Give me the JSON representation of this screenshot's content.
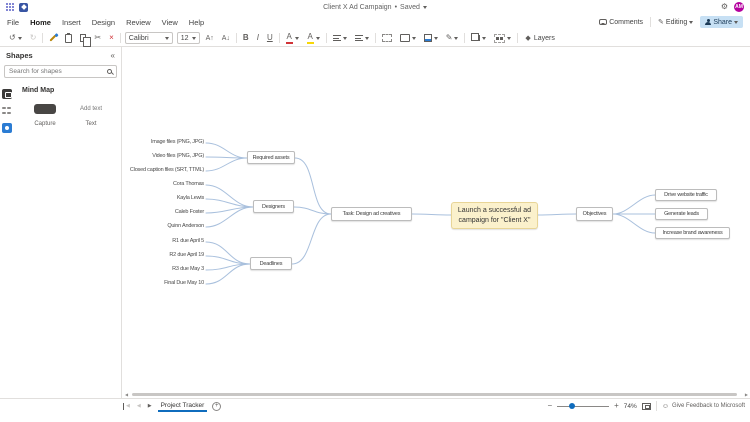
{
  "icons": {
    "undo": "↺",
    "redo": "↻",
    "cut": "✂",
    "delete": "×",
    "grow_font": "A↑",
    "shrink_font": "A↓",
    "bold": "B",
    "italic": "I",
    "underline": "U",
    "font_color": "A",
    "highlight": "A",
    "pencil": "✎",
    "layers": "◆",
    "gear": "⚙",
    "collapse_panel": "«",
    "prev": "◀",
    "next": "▶",
    "minus": "−",
    "plus": "+",
    "add_page": "+",
    "smiley": "☺"
  },
  "titlebar": {
    "title": "Client X Ad Campaign",
    "separator": "•",
    "status": "Saved",
    "avatar": "AM"
  },
  "menubar": {
    "items": [
      "File",
      "Home",
      "Insert",
      "Design",
      "Review",
      "View",
      "Help"
    ],
    "active": "Home",
    "comments": "Comments",
    "editing": "Editing",
    "share": "Share"
  },
  "toolbar": {
    "font_name": "Calibri",
    "font_size": "12",
    "layers": "Layers"
  },
  "shapes_panel": {
    "title": "Shapes",
    "search_placeholder": "Search for shapes",
    "section": "Mind Map",
    "item1_label": "Capture",
    "item2_preview": "Add text",
    "item2_label": "Text"
  },
  "mindmap": {
    "center": "Launch a successful ad campaign for \"Client X\"",
    "task": "Task: Design ad creatives",
    "objectives_hub": "Objectives",
    "assets_hub": "Required assets",
    "designers_hub": "Designers",
    "deadlines_hub": "Deadlines",
    "assets": [
      "Image files (PNG, JPG)",
      "Video files (PNG, JPG)",
      "Closed caption files (SRT, TTML)"
    ],
    "designers": [
      "Cora Thomas",
      "Kayla Lewis",
      "Caleb Foster",
      "Quinn Anderson"
    ],
    "deadlines": [
      "R1 due April 5",
      "R2 due April 19",
      "R3 due May 3",
      "Final Due May 10"
    ],
    "objectives": [
      "Drive website traffic",
      "Generate leads",
      "Increase brand awareness"
    ]
  },
  "statusbar": {
    "page": "Project Tracker",
    "zoom": "74%",
    "feedback": "Give Feedback to Microsoft"
  },
  "colors": {
    "accent": "#0f6cbd",
    "center_fill": "#fbf1cc",
    "connector": "#a9c0dd",
    "avatar": "#b4009e",
    "share_bg": "#c7e0f4"
  }
}
